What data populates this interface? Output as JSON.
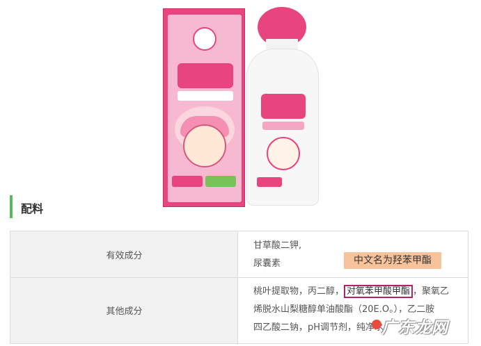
{
  "section": {
    "title": "配料"
  },
  "table": {
    "rows": [
      {
        "label": "有效成分",
        "lines": [
          "甘草酸二钾,",
          "尿囊素"
        ]
      },
      {
        "label": "其他成分",
        "line1_pre": "桃叶提取物，丙二醇，",
        "line1_hl": "对氧苯甲酸甲酯",
        "line1_post": "，聚氧乙",
        "line2": "烯脱水山梨糖醇单油酸酯（20E.O。），乙二胺",
        "line3": "四乙酸二钠，pH调节剂，纯净水"
      }
    ]
  },
  "annotation": {
    "text": "中文名为羟苯甲酯",
    "color": "#f8c39b"
  },
  "watermark": {
    "text": "广东龙网"
  },
  "colors": {
    "accent_green": "#5cb85c",
    "highlight_border": "#b0236b",
    "brand_pink": "#e8457e"
  }
}
